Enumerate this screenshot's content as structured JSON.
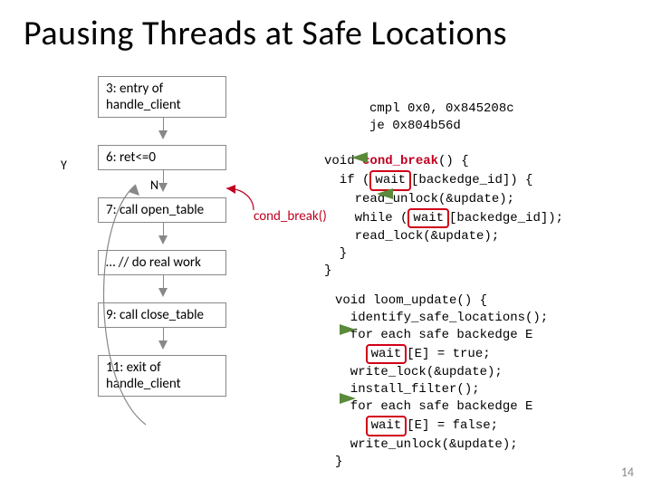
{
  "title": "Pausing Threads at Safe Locations",
  "slide_number": "14",
  "flow": {
    "node_entry": "3: entry of\nhandle_client",
    "node_ret": "6: ret<=0",
    "node_open": "7: call open_table",
    "node_dots": "… // do real work",
    "node_close": "9: call close_table",
    "node_exit": "11: exit of\nhandle_client",
    "label_y": "Y",
    "label_n": "N",
    "cond_break_label": "cond_break()"
  },
  "asm": {
    "l1": "cmpl 0x0, 0x845208c",
    "l2": "je 0x804b56d"
  },
  "cond_fn": {
    "sig_prefix": "void ",
    "sig_name": "cond_break",
    "sig_suffix": "() {",
    "if_pre": "  if (",
    "wait_var": "wait",
    "if_post": "[backedge_id]) {",
    "unlock": "    read_unlock(&update);",
    "while_pre": "    while (",
    "while_post": "[backedge_id]);",
    "lock": "    read_lock(&update);",
    "close_if": "  }",
    "close_fn": "}"
  },
  "loom_fn": {
    "sig": "void loom_update() {",
    "l1": "  identify_safe_locations();",
    "l2": "  for each safe backedge E",
    "l3_pre": "    ",
    "l3_post": "[E] = true;",
    "l4": "  write_lock(&update);",
    "l5": "  install_filter();",
    "l6": "  for each safe backedge E",
    "l7_pre": "    ",
    "l7_post": "[E] = false;",
    "l8": "  write_unlock(&update);",
    "close": "}"
  }
}
